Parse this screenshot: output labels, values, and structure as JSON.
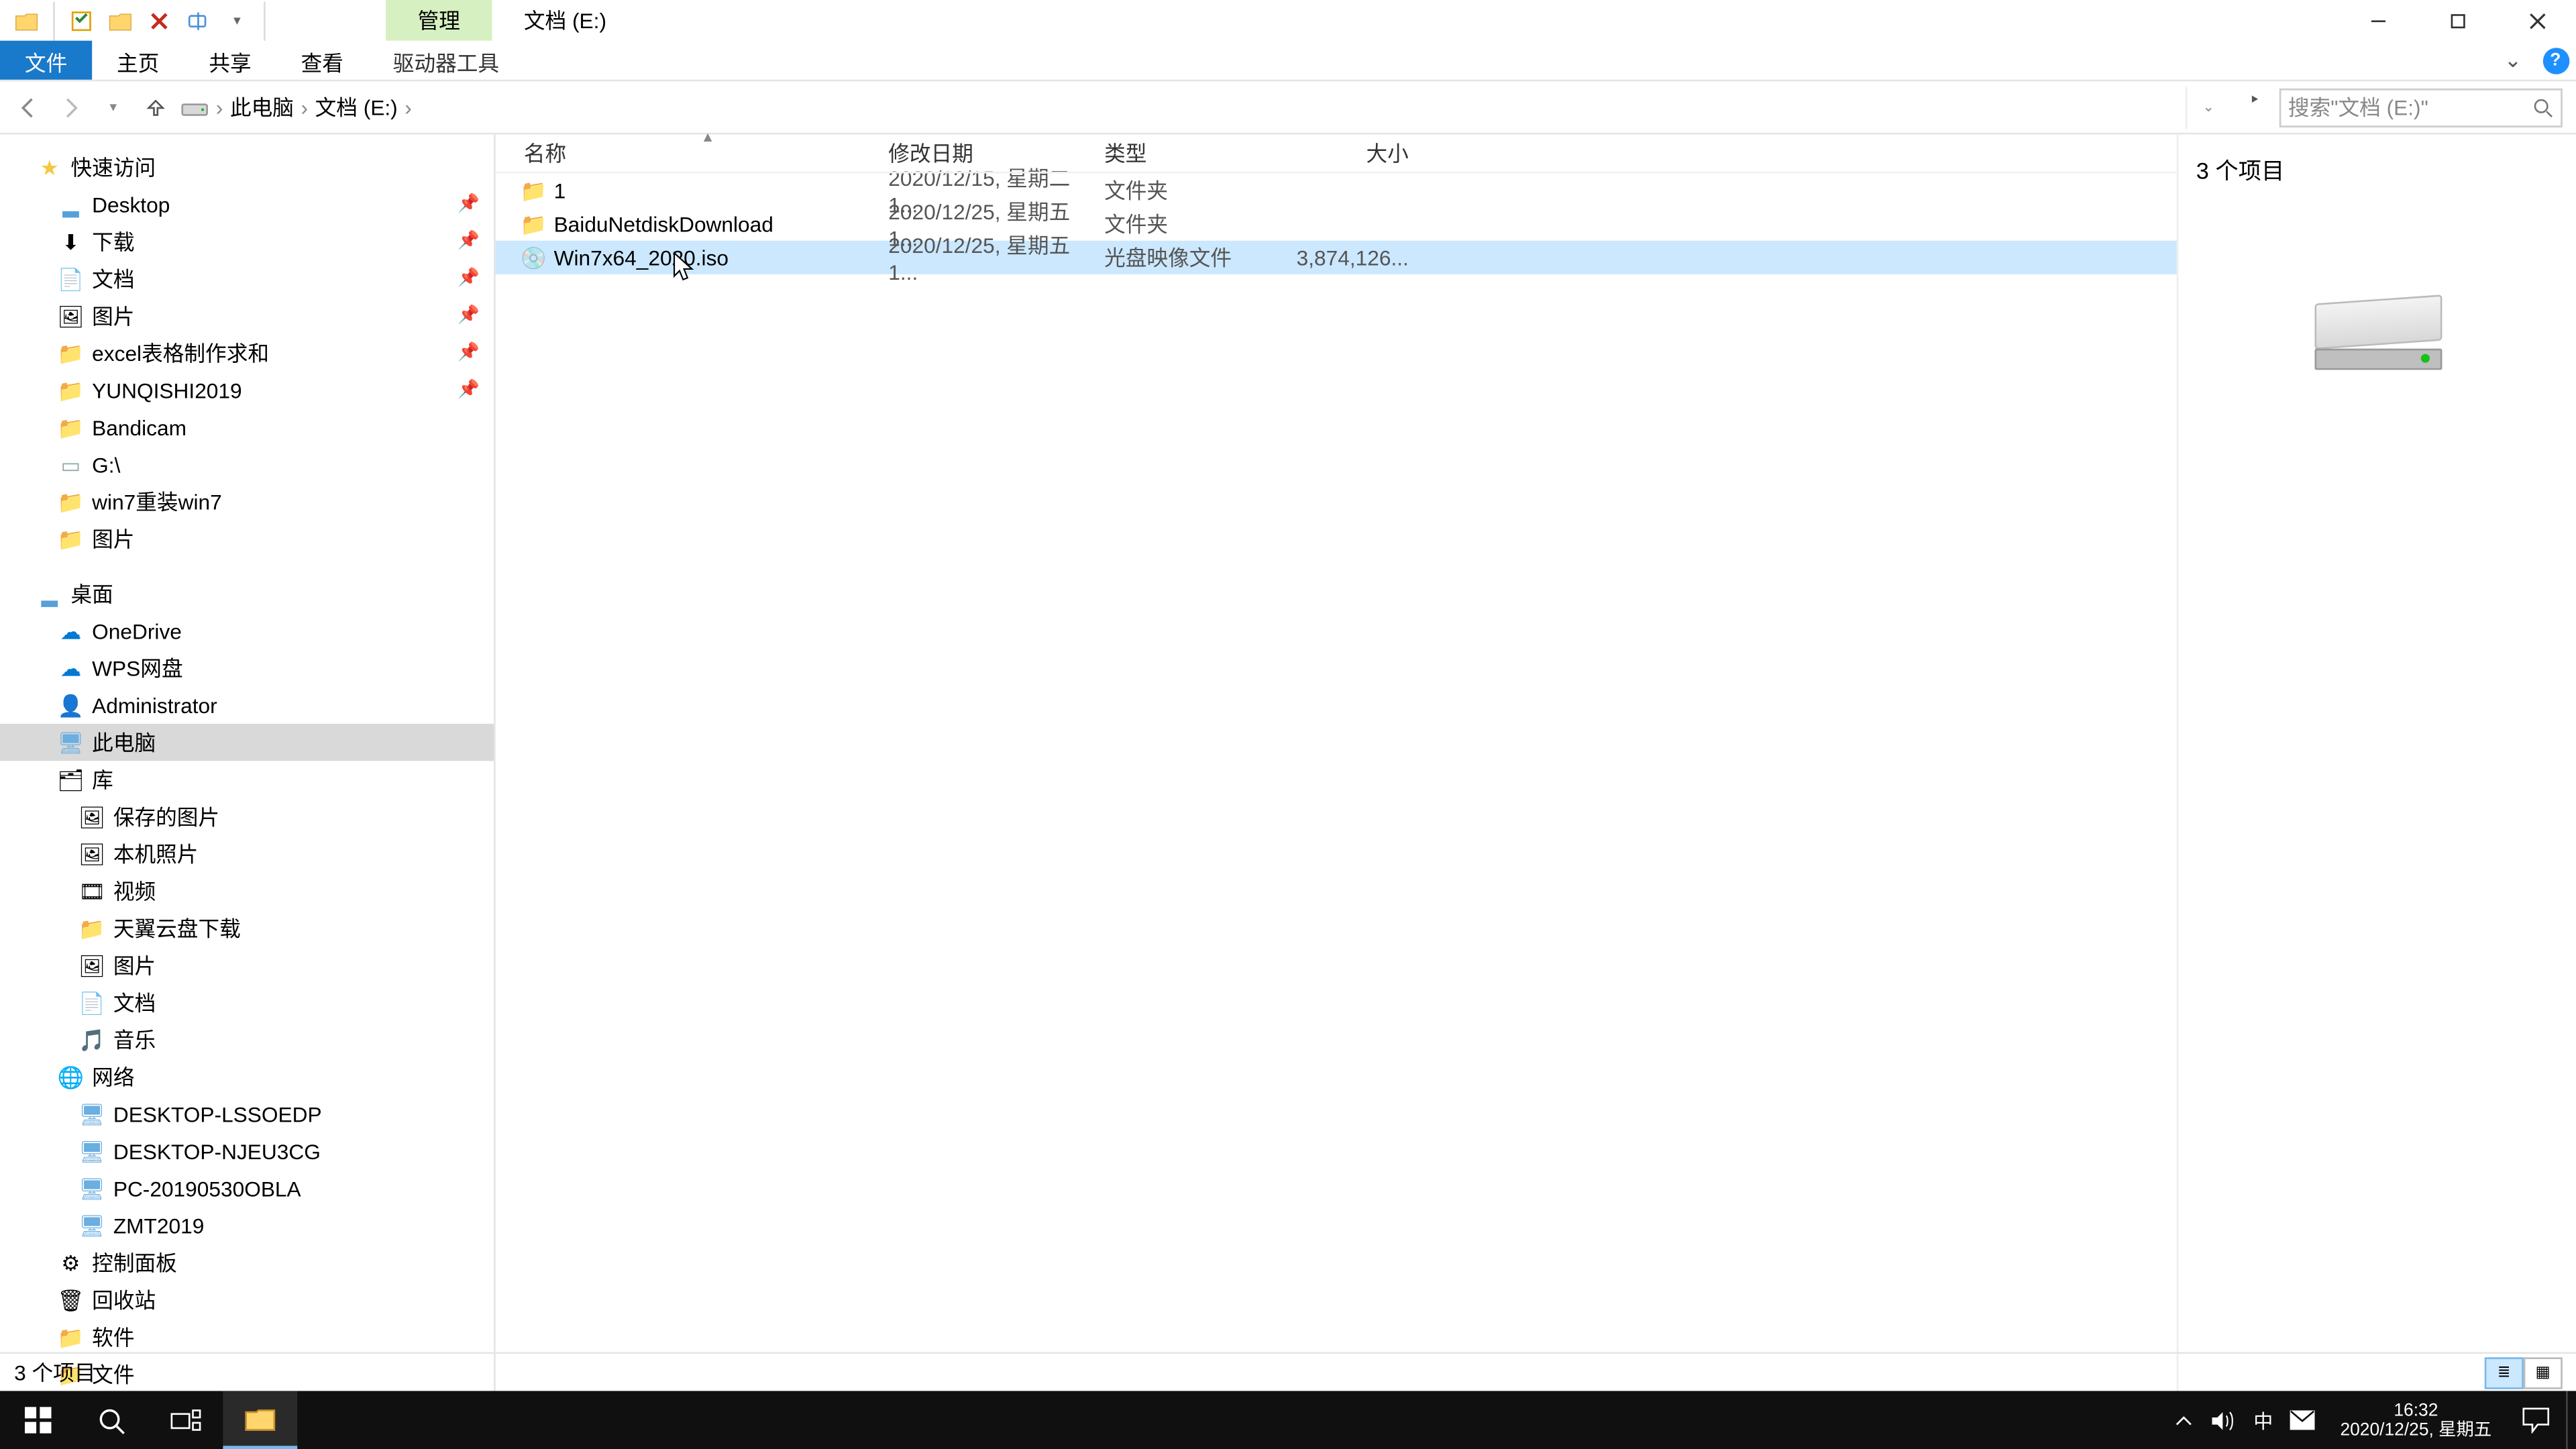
{
  "titlebar": {
    "contextual_tab": "管理",
    "location_tab": "文档 (E:)"
  },
  "ribbon": {
    "file": "文件",
    "home": "主页",
    "share": "共享",
    "view": "查看",
    "drive_tools": "驱动器工具"
  },
  "breadcrumb": {
    "root": "此电脑",
    "current": "文档 (E:)"
  },
  "search": {
    "placeholder": "搜索\"文档 (E:)\""
  },
  "tree": {
    "quick_access": "快速访问",
    "desktop": "Desktop",
    "downloads": "下载",
    "documents": "文档",
    "pictures": "图片",
    "excel": "excel表格制作求和",
    "yunqishi": "YUNQISHI2019",
    "bandicam": "Bandicam",
    "gdrive": "G:\\",
    "win7reinstall": "win7重装win7",
    "pictures2": "图片",
    "desktop_cn": "桌面",
    "onedrive": "OneDrive",
    "wps": "WPS网盘",
    "admin": "Administrator",
    "this_pc": "此电脑",
    "libraries": "库",
    "saved_pics": "保存的图片",
    "camera_roll": "本机照片",
    "videos": "视频",
    "tianyi": "天翼云盘下载",
    "lib_pictures": "图片",
    "lib_docs": "文档",
    "lib_music": "音乐",
    "network": "网络",
    "pc1": "DESKTOP-LSSOEDP",
    "pc2": "DESKTOP-NJEU3CG",
    "pc3": "PC-20190530OBLA",
    "pc4": "ZMT2019",
    "control_panel": "控制面板",
    "recycle": "回收站",
    "software": "软件",
    "files_folder": "文件"
  },
  "columns": {
    "name": "名称",
    "date": "修改日期",
    "type": "类型",
    "size": "大小"
  },
  "files": [
    {
      "name": "1",
      "date": "2020/12/15, 星期二 1...",
      "type": "文件夹",
      "size": "",
      "kind": "folder"
    },
    {
      "name": "BaiduNetdiskDownload",
      "date": "2020/12/25, 星期五 1...",
      "type": "文件夹",
      "size": "",
      "kind": "folder"
    },
    {
      "name": "Win7x64_2020.iso",
      "date": "2020/12/25, 星期五 1...",
      "type": "光盘映像文件",
      "size": "3,874,126...",
      "kind": "iso"
    }
  ],
  "preview": {
    "summary": "3 个项目"
  },
  "statusbar": {
    "text": "3 个项目"
  },
  "clock": {
    "time": "16:32",
    "date": "2020/12/25, 星期五"
  },
  "tray": {
    "ime": "中"
  }
}
